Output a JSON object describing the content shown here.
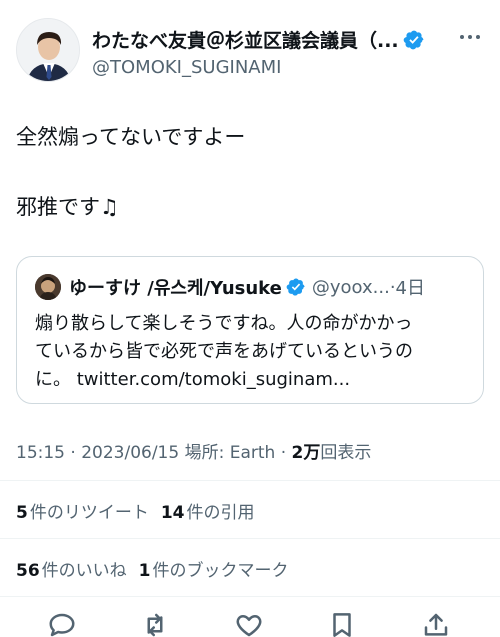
{
  "author": {
    "display_name": "わたなべ友貴＠杉並区議会議員（...",
    "handle": "@TOMOKI_SUGINAMI"
  },
  "tweet": {
    "line1": "全然煽ってないですよー",
    "line2": "邪推です",
    "line2_emoji": "♫"
  },
  "quoted_tweet": {
    "display_name": "ゆーすけ /유스케/Yusuke",
    "handle": "@yoox...",
    "separator": " · ",
    "time": "4日",
    "text_lines": [
      "煽り散らして楽しそうですね。人の命がかかっ",
      "ているから皆で必死で声をあげているというの",
      "に。 twitter.com/tomoki_suginam..."
    ]
  },
  "meta": {
    "timestamp_prefix": "15:15 · 2023/06/15 場所: Earth · ",
    "views_count": "2万",
    "views_label": "回表示"
  },
  "stats": {
    "retweets_count": "5",
    "retweets_label": "件のリツイート",
    "quotes_count": "14",
    "quotes_label": "件の引用",
    "likes_count": "56",
    "likes_label": "件のいいね",
    "bookmarks_count": "1",
    "bookmarks_label": "件のブックマーク"
  },
  "colors": {
    "verified": "#1d9bf0",
    "secondary_text": "#536471",
    "primary_text": "#0f1419",
    "border": "#cfd9de"
  },
  "icons": [
    "verified-badge-icon",
    "more-icon",
    "reply-icon",
    "retweet-icon",
    "like-icon",
    "bookmark-icon",
    "share-icon"
  ]
}
